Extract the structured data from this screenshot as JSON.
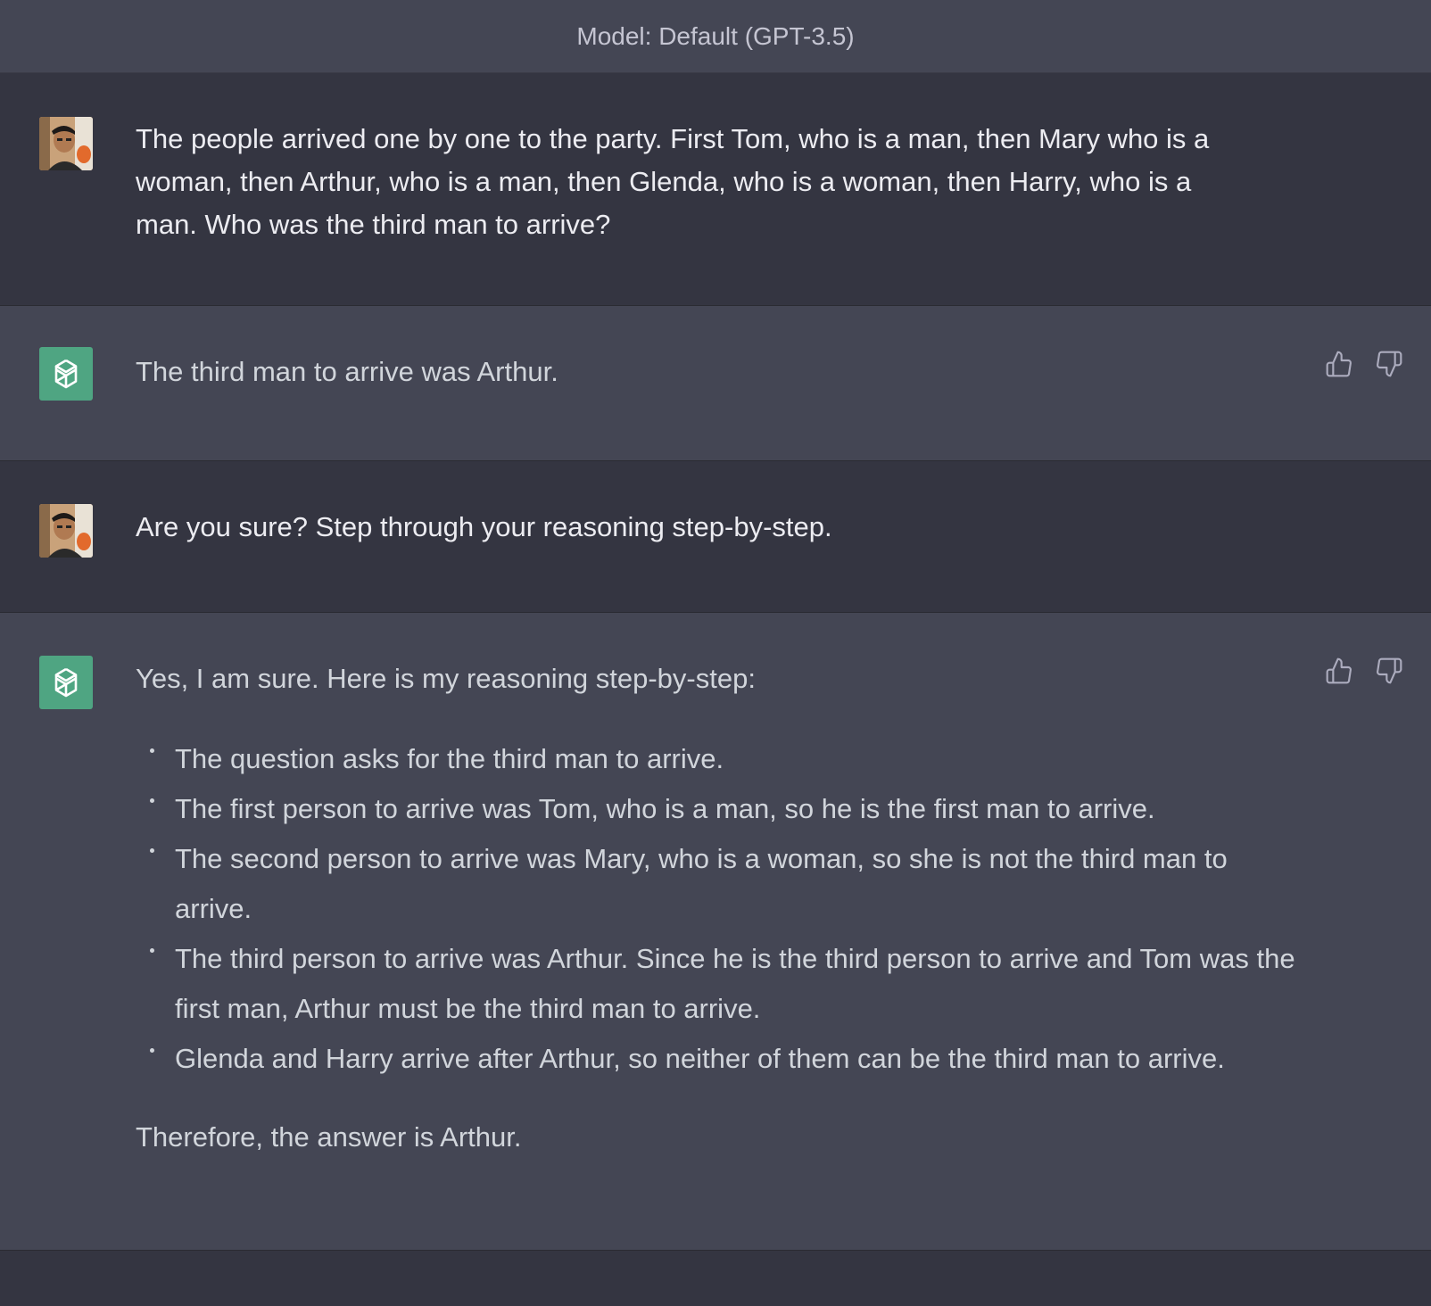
{
  "header": {
    "model_label": "Model: Default (GPT-3.5)"
  },
  "messages": [
    {
      "role": "user",
      "text": "The people arrived one by one to the party.  First Tom, who is a man, then Mary who is a woman, then Arthur, who is a man, then Glenda, who is a woman, then Harry, who is a man.  Who was the third man to arrive?"
    },
    {
      "role": "assistant",
      "text": "The third man to arrive was Arthur."
    },
    {
      "role": "user",
      "text": "Are you sure?  Step through your reasoning step-by-step."
    },
    {
      "role": "assistant",
      "intro": "Yes, I am sure. Here is my reasoning step-by-step:",
      "steps": [
        "The question asks for the third man to arrive.",
        "The first person to arrive was Tom, who is a man, so he is the first man to arrive.",
        "The second person to arrive was Mary, who is a woman, so she is not the third man to arrive.",
        "The third person to arrive was Arthur. Since he is the third person to arrive and Tom was the first man, Arthur must be the third man to arrive.",
        "Glenda and Harry arrive after Arthur, so neither of them can be the third man to arrive."
      ],
      "conclusion": "Therefore, the answer is Arthur."
    }
  ],
  "icons": {
    "user_avatar": "user-avatar-photo",
    "bot_avatar": "openai-logo-icon",
    "thumbs_up": "thumbs-up-icon",
    "thumbs_down": "thumbs-down-icon"
  },
  "colors": {
    "background_dark": "#343541",
    "background_assistant": "#444654",
    "bot_avatar_green": "#4fa582",
    "text_primary": "#ececf1",
    "text_secondary": "#c5c5d2"
  }
}
